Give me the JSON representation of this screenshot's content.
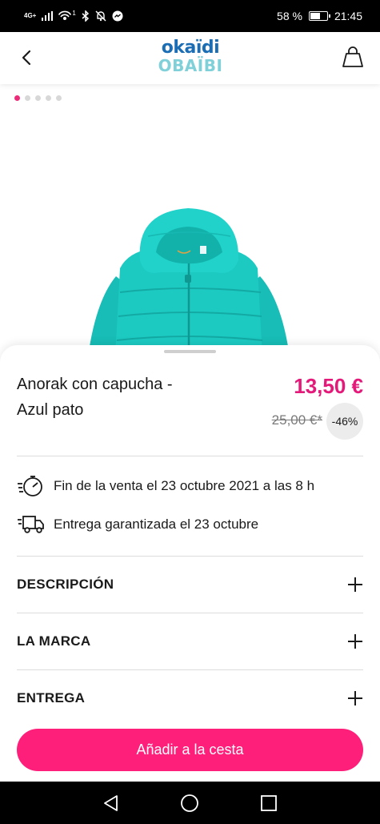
{
  "status_bar": {
    "network_label": "4G+",
    "signal_sup": "1",
    "battery": "58 %",
    "time": "21:45"
  },
  "header": {
    "logo_top": "okaïdi",
    "logo_bottom": "OBAÏBI"
  },
  "carousel": {
    "dot_count": 5,
    "active_index": 0
  },
  "product": {
    "name_line1": "Anorak con capucha -",
    "name_line2": "Azul pato",
    "price": "13,50 €",
    "old_price": "25,00 €*",
    "discount": "-46%"
  },
  "info": {
    "sale_end": "Fin de la venta el 23 octubre 2021 a las 8 h",
    "delivery": "Entrega garantizada el 23 octubre"
  },
  "accordion": [
    {
      "label": "DESCRIPCIÓN"
    },
    {
      "label": "LA MARCA"
    },
    {
      "label": "ENTREGA"
    }
  ],
  "cta": {
    "label": "Añadir a la cesta"
  },
  "colors": {
    "accent": "#fe1f7b",
    "price": "#e5197a",
    "logo_blue": "#1b6db4",
    "logo_cyan": "#7fd0d8",
    "jacket": "#1cc8c0"
  },
  "icons": {
    "back": "chevron-left-icon",
    "bag": "shopping-bag-icon",
    "timer": "stopwatch-icon",
    "truck": "delivery-truck-icon",
    "plus": "plus-icon"
  }
}
